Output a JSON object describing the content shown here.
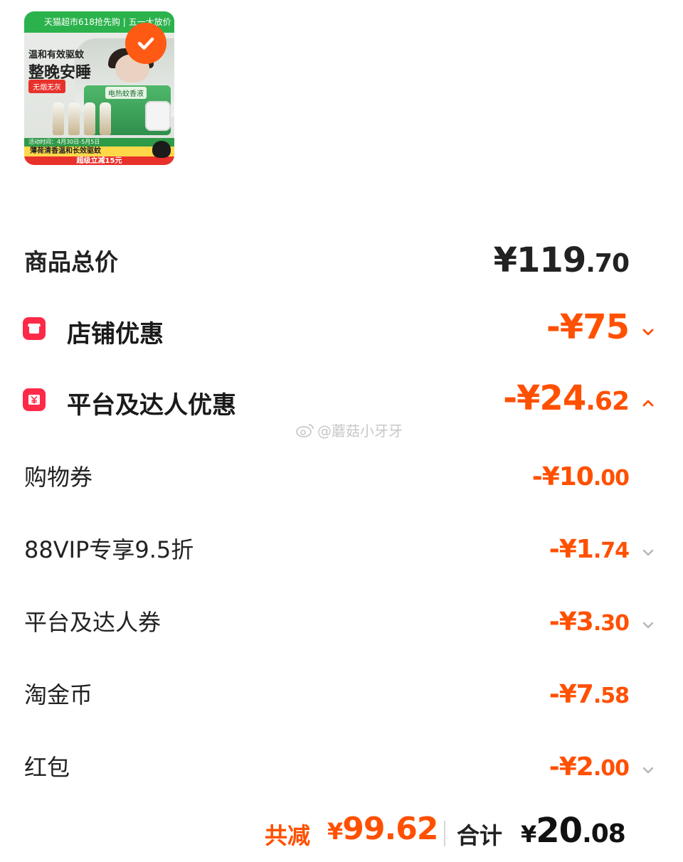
{
  "product": {
    "promo_banner": "天猫超市618抢先购 | 五一大放价",
    "headline": "温和有效驱蚊",
    "subheadline": "整晚安睡",
    "tag": "无烟无灰",
    "box_label": "电热蚊香液",
    "time_strip": "活动时间：4月30日-5月5日",
    "feature_bar": "薄荷清香温和长效驱蚊",
    "discount_bar": "超级立减15元",
    "selected": true
  },
  "summary": {
    "goods_total": {
      "label": "商品总价",
      "currency": "¥",
      "int": "119",
      "dec": ".70"
    },
    "store_discount": {
      "label": "店铺优惠",
      "sign": "-",
      "currency": "¥",
      "int": "75",
      "dec": "",
      "expanded": false
    },
    "platform_discount": {
      "label": "平台及达人优惠",
      "sign": "-",
      "currency": "¥",
      "int": "24",
      "dec": ".62",
      "expanded": true
    }
  },
  "details": [
    {
      "label": "购物券",
      "amount_int": "-¥10",
      "amount_dec": ".00",
      "has_chevron": false
    },
    {
      "label": "88VIP专享9.5折",
      "amount_int": "-¥1",
      "amount_dec": ".74",
      "has_chevron": true
    },
    {
      "label": "平台及达人券",
      "amount_int": "-¥3",
      "amount_dec": ".30",
      "has_chevron": true
    },
    {
      "label": "淘金币",
      "amount_int": "-¥7",
      "amount_dec": ".58",
      "has_chevron": false
    },
    {
      "label": "红包",
      "amount_int": "-¥2",
      "amount_dec": ".00",
      "has_chevron": true
    }
  ],
  "watermark": "@蘑菇小牙牙",
  "footer": {
    "saved_label": "共减",
    "saved_currency": "¥",
    "saved_amount": "99.62",
    "total_label": "合计",
    "total_currency": "¥",
    "total_int": "20",
    "total_dec": ".08"
  },
  "colors": {
    "accent": "#ff5000",
    "icon_red": "#ff2a47",
    "text": "#222222"
  }
}
